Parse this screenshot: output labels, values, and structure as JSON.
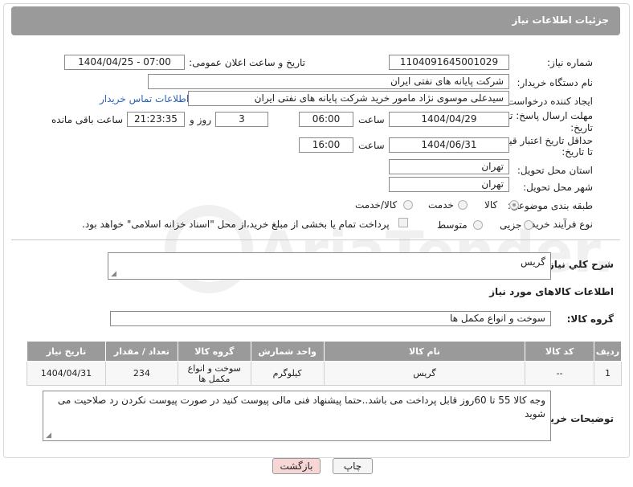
{
  "header": {
    "title": "جزئیات اطلاعات نیاز"
  },
  "form": {
    "need_number_label": "شماره نیاز:",
    "need_number": "1104091645001029",
    "announce_label": "تاریخ و ساعت اعلان عمومی:",
    "announce_value": "1404/04/25 - 07:00",
    "buyer_org_label": "نام دستگاه خریدار:",
    "buyer_org": "شرکت پایانه های نفتی ایران",
    "creator_label": "ایجاد کننده درخواست:",
    "creator": "سیدعلی موسوی نژاد مامور خرید شرکت پایانه های نفتی ایران",
    "contact_link": "اطلاعات تماس خریدار",
    "deadline_label_1": "مهلت ارسال پاسخ: تا",
    "deadline_label_2": "تاریخ:",
    "deadline_date": "1404/04/29",
    "time_label": "ساعت",
    "deadline_time": "06:00",
    "days_value": "3",
    "days_label": "روز و",
    "remaining_time": "21:23:35",
    "remaining_label": "ساعت باقی مانده",
    "validity_label_1": "حداقل تاریخ اعتبار قیمت:",
    "validity_label_2": "تا تاریخ:",
    "validity_date": "1404/06/31",
    "validity_time": "16:00",
    "province_label": "استان محل تحویل:",
    "province": "تهران",
    "city_label": "شهر محل تحویل:",
    "city": "تهران",
    "category_label": "طبقه بندی موضوعی:",
    "category_options": [
      "کالا",
      "خدمت",
      "کالا/خدمت"
    ],
    "process_label": "نوع فرآیند خرید :",
    "process_options": [
      "جزیی",
      "متوسط"
    ],
    "payment_note": "پرداخت تمام یا بخشی از مبلغ خرید،از محل \"اسناد خزانه اسلامی\" خواهد بود."
  },
  "summary": {
    "label": "شرح کلي نياز:",
    "value": "گریس"
  },
  "goods_section": {
    "title": "اطلاعات کالاهای مورد نیاز",
    "group_label": "گروه کالا:",
    "group_value": "سوخت و انواع مکمل ها"
  },
  "table": {
    "headers": [
      "ردیف",
      "کد کالا",
      "نام کالا",
      "واحد شمارش",
      "گروه کالا",
      "تعداد / مقدار",
      "تاریخ نیاز"
    ],
    "rows": [
      [
        "1",
        "--",
        "گریس",
        "کیلوگرم",
        "سوخت و انواع مکمل ها",
        "234",
        "1404/04/31"
      ]
    ]
  },
  "buyer_notes": {
    "label": "توضیحات خریدار:",
    "value": "وجه کالا 55 تا 60روز قابل پرداخت می باشد..حتما پیشنهاد فنی مالی پیوست کنید در صورت پیوست نکردن رد صلاحیت می شوید"
  },
  "buttons": {
    "print": "چاپ",
    "back": "بازگشت"
  },
  "watermark": {
    "text": "AriaTender.net"
  },
  "colors": {
    "header_bg": "#9a9a9a",
    "link": "#2a62b5",
    "back_button": "#f7d6d6"
  }
}
